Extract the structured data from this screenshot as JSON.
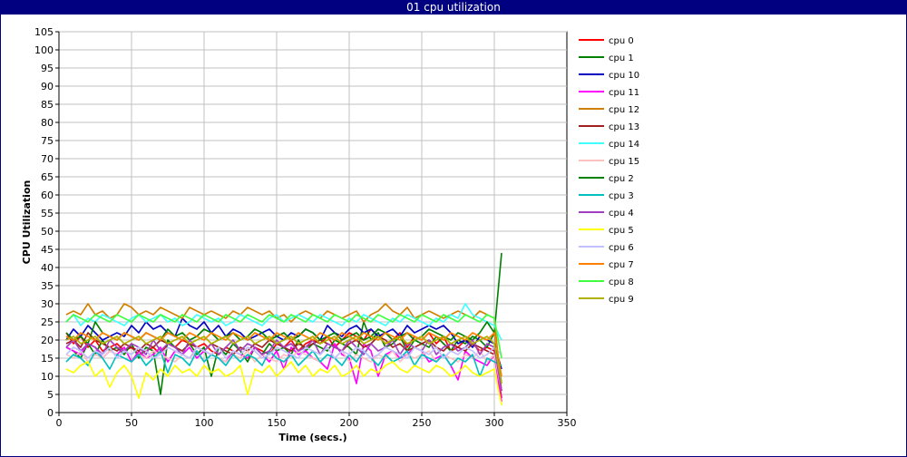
{
  "window": {
    "title": "01 cpu utilization"
  },
  "chart_data": {
    "type": "line",
    "title": "01 cpu utilization",
    "xlabel": "Time (secs.)",
    "ylabel": "CPU Utilization",
    "xlim": [
      0,
      350
    ],
    "ylim": [
      0,
      105
    ],
    "xticks": [
      0,
      50,
      100,
      150,
      200,
      250,
      300,
      350
    ],
    "yticks": [
      0,
      5,
      10,
      15,
      20,
      25,
      30,
      35,
      40,
      45,
      50,
      55,
      60,
      65,
      70,
      75,
      80,
      85,
      90,
      95,
      100,
      105
    ],
    "grid": true,
    "legend_position": "right",
    "x": [
      5,
      10,
      15,
      20,
      25,
      30,
      35,
      40,
      45,
      50,
      55,
      60,
      65,
      70,
      75,
      80,
      85,
      90,
      95,
      100,
      105,
      110,
      115,
      120,
      125,
      130,
      135,
      140,
      145,
      150,
      155,
      160,
      165,
      170,
      175,
      180,
      185,
      190,
      195,
      200,
      205,
      210,
      215,
      220,
      225,
      230,
      235,
      240,
      245,
      250,
      255,
      260,
      265,
      270,
      275,
      280,
      285,
      290,
      295,
      300,
      305
    ],
    "series": [
      {
        "name": "cpu 0",
        "color": "#ff0000",
        "values": [
          22,
          19,
          21,
          18,
          20,
          17,
          18,
          19,
          17,
          18,
          16,
          17,
          18,
          16,
          19,
          18,
          20,
          19,
          18,
          19,
          17,
          16,
          18,
          17,
          16,
          15,
          18,
          17,
          16,
          19,
          18,
          20,
          17,
          19,
          20,
          19,
          21,
          18,
          20,
          22,
          21,
          20,
          23,
          21,
          19,
          20,
          22,
          18,
          21,
          20,
          22,
          19,
          21,
          17,
          18,
          20,
          19,
          17,
          18,
          17,
          4
        ]
      },
      {
        "name": "cpu 1",
        "color": "#008000",
        "values": [
          18,
          17,
          15,
          19,
          16,
          20,
          17,
          18,
          16,
          19,
          15,
          18,
          17,
          5,
          20,
          18,
          17,
          19,
          16,
          18,
          10,
          18,
          16,
          19,
          17,
          14,
          18,
          16,
          19,
          17,
          18,
          16,
          20,
          17,
          19,
          18,
          17,
          20,
          19,
          18,
          16,
          25,
          20,
          22,
          18,
          19,
          21,
          17,
          20,
          19,
          18,
          21,
          19,
          17,
          20,
          19,
          21,
          20,
          18,
          22,
          44
        ]
      },
      {
        "name": "cpu 10",
        "color": "#0000c0",
        "values": [
          20,
          23,
          21,
          24,
          22,
          20,
          21,
          22,
          21,
          24,
          22,
          25,
          23,
          24,
          22,
          21,
          26,
          24,
          23,
          25,
          22,
          24,
          21,
          23,
          22,
          20,
          21,
          22,
          23,
          21,
          20,
          22,
          21,
          23,
          22,
          20,
          24,
          22,
          21,
          23,
          24,
          22,
          23,
          21,
          22,
          23,
          21,
          24,
          22,
          23,
          24,
          23,
          24,
          22,
          19,
          20,
          18,
          21,
          20,
          19,
          12
        ]
      },
      {
        "name": "cpu 11",
        "color": "#ff00ff",
        "values": [
          18,
          17,
          16,
          19,
          18,
          15,
          17,
          16,
          18,
          14,
          17,
          15,
          16,
          18,
          14,
          17,
          16,
          18,
          15,
          17,
          16,
          15,
          14,
          17,
          16,
          15,
          18,
          16,
          14,
          17,
          12,
          18,
          16,
          17,
          15,
          14,
          12,
          19,
          16,
          15,
          8,
          19,
          17,
          10,
          16,
          17,
          15,
          16,
          18,
          17,
          14,
          15,
          16,
          13,
          9,
          17,
          15,
          14,
          13,
          16,
          3
        ]
      },
      {
        "name": "cpu 12",
        "color": "#d08000",
        "values": [
          27,
          28,
          27,
          30,
          27,
          28,
          26,
          27,
          30,
          29,
          27,
          28,
          27,
          29,
          28,
          27,
          26,
          29,
          28,
          27,
          28,
          27,
          26,
          28,
          27,
          29,
          28,
          27,
          28,
          26,
          27,
          25,
          27,
          28,
          27,
          26,
          28,
          27,
          26,
          27,
          28,
          25,
          27,
          28,
          30,
          28,
          27,
          29,
          26,
          27,
          28,
          27,
          26,
          27,
          28,
          27,
          26,
          28,
          27,
          26,
          6
        ]
      },
      {
        "name": "cpu 13",
        "color": "#a02020",
        "values": [
          19,
          20,
          18,
          22,
          20,
          19,
          18,
          17,
          19,
          18,
          17,
          19,
          18,
          20,
          19,
          18,
          17,
          19,
          18,
          17,
          19,
          18,
          17,
          16,
          18,
          17,
          19,
          18,
          20,
          19,
          18,
          17,
          19,
          18,
          19,
          20,
          19,
          18,
          17,
          19,
          20,
          18,
          19,
          21,
          20,
          18,
          19,
          17,
          18,
          19,
          20,
          18,
          17,
          19,
          18,
          17,
          19,
          18,
          17,
          16,
          6
        ]
      },
      {
        "name": "cpu 14",
        "color": "#40ffff",
        "values": [
          25,
          27,
          24,
          26,
          25,
          27,
          26,
          25,
          24,
          26,
          27,
          25,
          26,
          27,
          25,
          26,
          24,
          25,
          27,
          26,
          25,
          26,
          24,
          25,
          27,
          26,
          25,
          24,
          26,
          27,
          25,
          26,
          27,
          26,
          25,
          27,
          26,
          25,
          24,
          26,
          25,
          27,
          26,
          25,
          24,
          26,
          25,
          27,
          26,
          25,
          24,
          26,
          25,
          27,
          26,
          30,
          27,
          26,
          25,
          24,
          20
        ]
      },
      {
        "name": "cpu 15",
        "color": "#ffc0c0",
        "values": [
          16,
          15,
          17,
          14,
          16,
          15,
          17,
          16,
          15,
          14,
          16,
          15,
          17,
          16,
          15,
          14,
          16,
          15,
          17,
          14,
          16,
          15,
          14,
          16,
          15,
          17,
          14,
          16,
          15,
          14,
          16,
          15,
          17,
          16,
          15,
          14,
          16,
          15,
          17,
          14,
          16,
          15,
          14,
          16,
          15,
          17,
          14,
          16,
          15,
          16,
          17,
          14,
          16,
          15,
          14,
          16,
          15,
          17,
          14,
          16,
          6
        ]
      },
      {
        "name": "cpu 2",
        "color": "#008000",
        "values": [
          22,
          20,
          21,
          19,
          25,
          22,
          21,
          20,
          22,
          21,
          20,
          22,
          21,
          20,
          23,
          21,
          22,
          20,
          21,
          23,
          22,
          20,
          21,
          22,
          20,
          21,
          23,
          22,
          20,
          21,
          22,
          20,
          21,
          23,
          22,
          20,
          21,
          22,
          20,
          21,
          22,
          20,
          21,
          23,
          22,
          20,
          21,
          22,
          20,
          21,
          23,
          22,
          21,
          20,
          22,
          21,
          20,
          22,
          25,
          22,
          8
        ]
      },
      {
        "name": "cpu 3",
        "color": "#00c0c0",
        "values": [
          14,
          16,
          15,
          13,
          17,
          15,
          12,
          16,
          15,
          14,
          16,
          13,
          15,
          17,
          11,
          16,
          15,
          13,
          17,
          14,
          16,
          15,
          13,
          16,
          14,
          16,
          15,
          13,
          17,
          15,
          14,
          16,
          13,
          15,
          17,
          14,
          16,
          15,
          13,
          16,
          14,
          17,
          15,
          13,
          16,
          14,
          15,
          17,
          13,
          16,
          15,
          14,
          16,
          13,
          15,
          14,
          16,
          10,
          15,
          14,
          13
        ]
      },
      {
        "name": "cpu 4",
        "color": "#a040c0",
        "values": [
          18,
          20,
          17,
          19,
          18,
          16,
          20,
          18,
          17,
          19,
          18,
          16,
          20,
          17,
          19,
          18,
          16,
          20,
          18,
          17,
          19,
          16,
          18,
          20,
          17,
          19,
          18,
          16,
          17,
          20,
          18,
          19,
          17,
          18,
          20,
          16,
          19,
          18,
          17,
          20,
          18,
          16,
          19,
          17,
          18,
          20,
          16,
          19,
          18,
          17,
          20,
          16,
          18,
          19,
          17,
          18,
          20,
          16,
          19,
          18,
          6
        ]
      },
      {
        "name": "cpu 5",
        "color": "#ffff00",
        "values": [
          12,
          11,
          13,
          14,
          10,
          12,
          7,
          11,
          13,
          10,
          4,
          11,
          9,
          12,
          10,
          13,
          11,
          12,
          10,
          13,
          11,
          12,
          10,
          11,
          13,
          5,
          12,
          11,
          13,
          10,
          12,
          14,
          11,
          13,
          10,
          12,
          11,
          13,
          10,
          11,
          13,
          10,
          12,
          11,
          13,
          14,
          12,
          11,
          13,
          12,
          11,
          13,
          12,
          10,
          11,
          13,
          11,
          10,
          11,
          12,
          2
        ]
      },
      {
        "name": "cpu 6",
        "color": "#c0c0ff",
        "values": [
          16,
          18,
          17,
          15,
          17,
          16,
          18,
          15,
          17,
          16,
          18,
          17,
          15,
          16,
          18,
          17,
          16,
          15,
          18,
          17,
          16,
          18,
          15,
          17,
          16,
          18,
          17,
          15,
          16,
          18,
          17,
          16,
          15,
          18,
          17,
          16,
          18,
          15,
          17,
          16,
          18,
          17,
          15,
          16,
          18,
          17,
          16,
          15,
          18,
          17,
          16,
          18,
          15,
          17,
          16,
          18,
          17,
          15,
          16,
          18,
          16
        ]
      },
      {
        "name": "cpu 7",
        "color": "#ff8000",
        "values": [
          21,
          20,
          22,
          21,
          20,
          22,
          21,
          20,
          22,
          21,
          20,
          22,
          21,
          20,
          22,
          21,
          20,
          22,
          21,
          20,
          22,
          21,
          20,
          22,
          21,
          20,
          22,
          21,
          20,
          22,
          21,
          20,
          22,
          21,
          20,
          22,
          21,
          20,
          22,
          21,
          20,
          22,
          21,
          20,
          22,
          21,
          20,
          22,
          21,
          20,
          22,
          21,
          20,
          22,
          21,
          20,
          22,
          21,
          20,
          22,
          10
        ]
      },
      {
        "name": "cpu 8",
        "color": "#40ff40",
        "values": [
          25,
          27,
          26,
          25,
          27,
          26,
          25,
          27,
          26,
          25,
          27,
          26,
          25,
          27,
          26,
          25,
          27,
          26,
          25,
          27,
          26,
          25,
          27,
          26,
          25,
          27,
          26,
          25,
          27,
          26,
          25,
          27,
          26,
          25,
          27,
          26,
          25,
          27,
          26,
          25,
          27,
          26,
          25,
          27,
          26,
          25,
          27,
          26,
          25,
          27,
          26,
          25,
          27,
          26,
          25,
          27,
          26,
          25,
          27,
          26,
          15
        ]
      },
      {
        "name": "cpu 9",
        "color": "#b0b000",
        "values": [
          20,
          21,
          19,
          20,
          21,
          19,
          20,
          21,
          19,
          20,
          21,
          19,
          20,
          21,
          19,
          20,
          21,
          19,
          20,
          21,
          19,
          20,
          21,
          19,
          20,
          21,
          19,
          20,
          21,
          19,
          20,
          21,
          19,
          20,
          21,
          19,
          20,
          21,
          19,
          20,
          21,
          19,
          20,
          21,
          19,
          20,
          21,
          19,
          20,
          21,
          19,
          20,
          21,
          19,
          20,
          21,
          19,
          20,
          21,
          19,
          8
        ]
      }
    ]
  }
}
